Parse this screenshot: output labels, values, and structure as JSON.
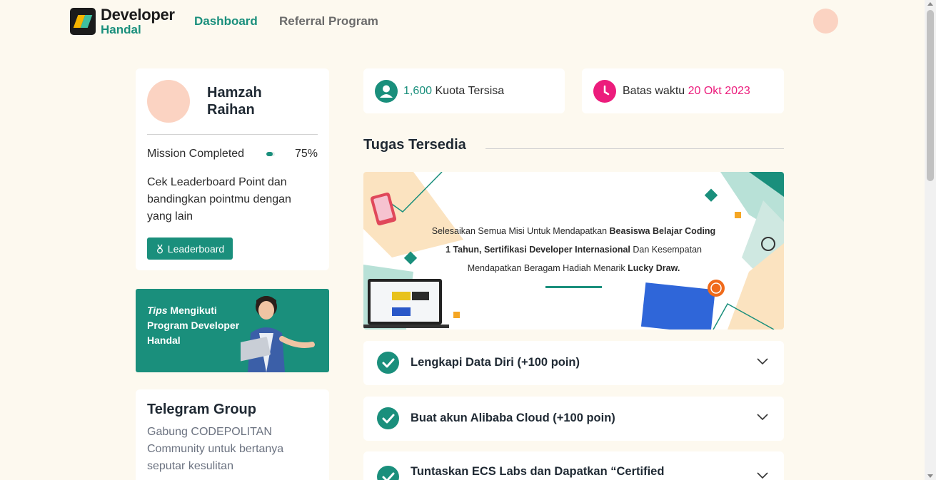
{
  "header": {
    "logo_line1": "Developer",
    "logo_line2": "Handal",
    "nav": [
      {
        "label": "Dashboard",
        "active": true
      },
      {
        "label": "Referral Program",
        "active": false
      }
    ]
  },
  "profile": {
    "name": "Hamzah Raihan",
    "mission_label": "Mission Completed",
    "mission_progress": 0.75,
    "mission_percent": "75%",
    "leaderboard_text": "Cek Leaderboard Point dan bandingkan pointmu dengan yang lain",
    "leaderboard_button": "Leaderboard"
  },
  "tips": {
    "italic": "Tips",
    "text_rest": " Mengikuti Program Developer Handal"
  },
  "telegram": {
    "title": "Telegram Group",
    "description": "Gabung CODEPOLITAN Community untuk bertanya seputar kesulitan"
  },
  "quota": {
    "value": "1,600",
    "label": " Kuota Tersisa"
  },
  "deadline": {
    "label": "Batas waktu ",
    "value": "20 Okt 2023"
  },
  "section": {
    "title": "Tugas Tersedia"
  },
  "banner": {
    "line1_a": "Selesaikan Semua Misi Untuk Mendapatkan ",
    "line1_b": "Beasiswa Belajar Coding",
    "line2_a": "1 Tahun, Sertifikasi Developer Internasional",
    "line2_b": " Dan Kesempatan",
    "line3_a": "Mendapatkan Beragam Hadiah Menarik ",
    "line3_b": "Lucky Draw."
  },
  "tasks": [
    {
      "title": "Lengkapi Data Diri (+100 poin)"
    },
    {
      "title": "Buat akun Alibaba Cloud (+100 poin)"
    },
    {
      "title": "Tuntaskan ECS Labs dan Dapatkan “Certified"
    }
  ],
  "colors": {
    "accent": "#1a8f7c",
    "pink": "#ec1c7c",
    "background": "#fdf9ef",
    "avatar": "#fbd3c2"
  },
  "icons": {
    "quota": "user-icon",
    "deadline": "clock-icon",
    "task": "check-circle-icon",
    "expand": "chevron-down-icon",
    "leaderboard": "medal-icon"
  }
}
